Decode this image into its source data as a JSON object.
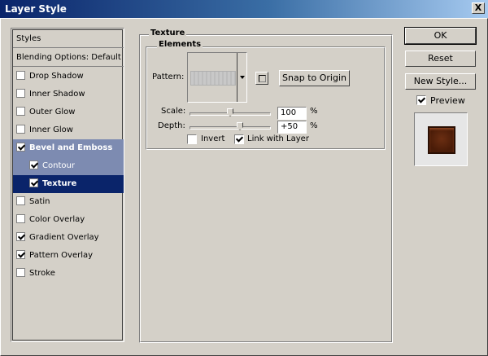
{
  "window": {
    "title": "Layer Style",
    "close_label": "X"
  },
  "styles_list": {
    "header": "Styles",
    "blending": "Blending Options: Default",
    "items": [
      {
        "label": "Drop Shadow",
        "checked": false
      },
      {
        "label": "Inner Shadow",
        "checked": false
      },
      {
        "label": "Outer Glow",
        "checked": false
      },
      {
        "label": "Inner Glow",
        "checked": false
      },
      {
        "label": "Bevel and Emboss",
        "checked": true
      },
      {
        "label": "Contour",
        "checked": true
      },
      {
        "label": "Texture",
        "checked": true
      },
      {
        "label": "Satin",
        "checked": false
      },
      {
        "label": "Color Overlay",
        "checked": false
      },
      {
        "label": "Gradient Overlay",
        "checked": true
      },
      {
        "label": "Pattern Overlay",
        "checked": true
      },
      {
        "label": "Stroke",
        "checked": false
      }
    ]
  },
  "texture": {
    "group_title": "Texture",
    "elements_title": "Elements",
    "pattern_label": "Pattern:",
    "snap_button": "Snap to Origin",
    "scale_label": "Scale:",
    "scale_value": "100",
    "scale_unit": "%",
    "depth_label": "Depth:",
    "depth_value": "+50",
    "depth_unit": "%",
    "invert_label": "Invert",
    "invert_checked": false,
    "link_label": "Link with Layer",
    "link_checked": true
  },
  "actions": {
    "ok": "OK",
    "reset": "Reset",
    "new_style": "New Style...",
    "preview_label": "Preview",
    "preview_checked": true
  }
}
